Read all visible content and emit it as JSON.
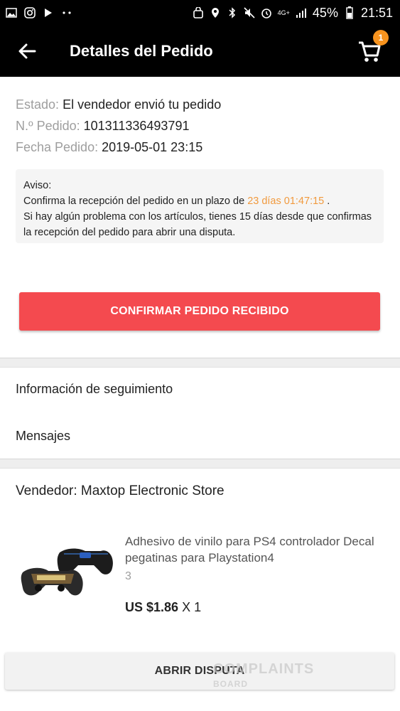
{
  "status_bar": {
    "battery": "45%",
    "time": "21:51",
    "network": "4G+"
  },
  "header": {
    "title": "Detalles del Pedido",
    "cart_count": "1"
  },
  "order": {
    "status_label": "Estado:",
    "status_value": "El vendedor envió tu pedido",
    "order_no_label": "N.º Pedido:",
    "order_no_value": "101311336493791",
    "date_label": "Fecha Pedido:",
    "date_value": "2019-05-01 23:15"
  },
  "notice": {
    "title": "Aviso:",
    "line1_prefix": "Confirma la recepción del pedido en un plazo de ",
    "countdown": "23 días 01:47:15",
    "line1_suffix": " .",
    "line2": "Si hay algún problema con los artículos, tienes 15 días desde que confirmas la recepción del pedido para abrir una disputa."
  },
  "actions": {
    "confirm_label": "CONFIRMAR PEDIDO RECIBIDO",
    "dispute_label": "ABRIR DISPUTA"
  },
  "menu": {
    "tracking": "Información de seguimiento",
    "messages": "Mensajes"
  },
  "seller": {
    "label": "Vendedor: Maxtop Electronic Store"
  },
  "product": {
    "title": "Adhesivo de vinilo para PS4 controlador Decal pegatinas para Playstation4",
    "variant": "3",
    "price": "US $1.86",
    "quantity": "X 1"
  },
  "watermark": {
    "text": "COMPLAINTS",
    "sub": "BOARD"
  },
  "colors": {
    "primary_red": "#f44a4f",
    "countdown_orange": "#f19a3e",
    "badge_orange": "#f7931e",
    "header_bg": "#000000"
  }
}
